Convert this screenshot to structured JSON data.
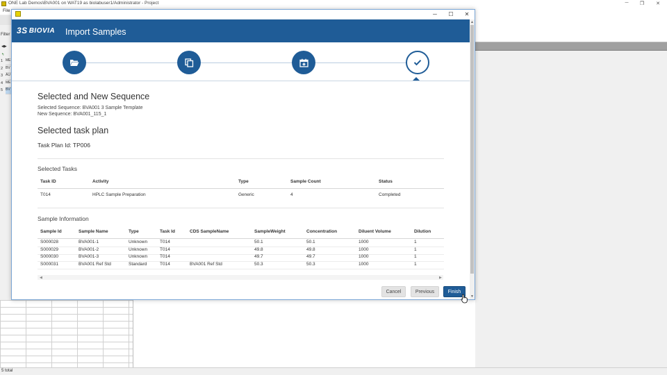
{
  "main_window": {
    "title": "ONE Lab Demos\\BVA001 on WAT19 as biolabuser1/Administrator - Project",
    "menu_file": "File",
    "filter_label": "Filter",
    "left_rows": [
      {
        "num": "1",
        "cell": "ME"
      },
      {
        "num": "2",
        "cell": "BV"
      },
      {
        "num": "3",
        "cell": "AU"
      },
      {
        "num": "4",
        "cell": "ME"
      },
      {
        "num": "5",
        "cell": "BV"
      }
    ],
    "status_text": "5 total",
    "controls": {
      "minimize": "─",
      "restore": "❐",
      "close": "✕"
    }
  },
  "dialog": {
    "controls": {
      "minimize": "─",
      "maximize": "☐",
      "close": "✕"
    },
    "logo_mark": "3S",
    "logo_text": "BIOVIA",
    "heading": "Import Samples",
    "wizard_steps": [
      {
        "icon": "folder-open-icon",
        "state": "done"
      },
      {
        "icon": "copy-icon",
        "state": "done"
      },
      {
        "icon": "calendar-icon",
        "state": "done"
      },
      {
        "icon": "check-icon",
        "state": "current"
      }
    ],
    "sequence_title": "Selected and New Sequence",
    "selected_sequence": "Selected Sequence: BVA001 3 Sample Template",
    "new_sequence": "New Sequence: BVA001_115_1",
    "task_plan_title": "Selected task plan",
    "task_plan_id": "Task Plan Id: TP006",
    "tasks_title": "Selected Tasks",
    "tasks_columns": [
      "Task ID",
      "Activity",
      "Type",
      "Sample Count",
      "Status"
    ],
    "tasks_rows": [
      [
        "T014",
        "HPLC Sample Preparation",
        "Generic",
        "4",
        "Completed"
      ]
    ],
    "samples_title": "Sample Information",
    "samples_columns": [
      "Sample Id",
      "Sample Name",
      "Type",
      "Task Id",
      "CDS SampleName",
      "SampleWeight",
      "Concentration",
      "Diluent Volume",
      "Dilution"
    ],
    "samples_rows": [
      [
        "S000028",
        "BVA001-1",
        "Unknown",
        "T014",
        "",
        "50.1",
        "50.1",
        "1000",
        "1"
      ],
      [
        "S000029",
        "BVA001-2",
        "Unknown",
        "T014",
        "",
        "49.8",
        "49.8",
        "1000",
        "1"
      ],
      [
        "S000030",
        "BVA001-3",
        "Unknown",
        "T014",
        "",
        "49.7",
        "49.7",
        "1000",
        "1"
      ],
      [
        "S000031",
        "BVA001 Ref Std",
        "Standard",
        "T014",
        "BVA001 Ref Std",
        "50.3",
        "50.3",
        "1000",
        "1"
      ]
    ],
    "buttons": {
      "cancel": "Cancel",
      "previous": "Previous",
      "finish": "Finish"
    },
    "accent_color": "#1f5c97"
  }
}
